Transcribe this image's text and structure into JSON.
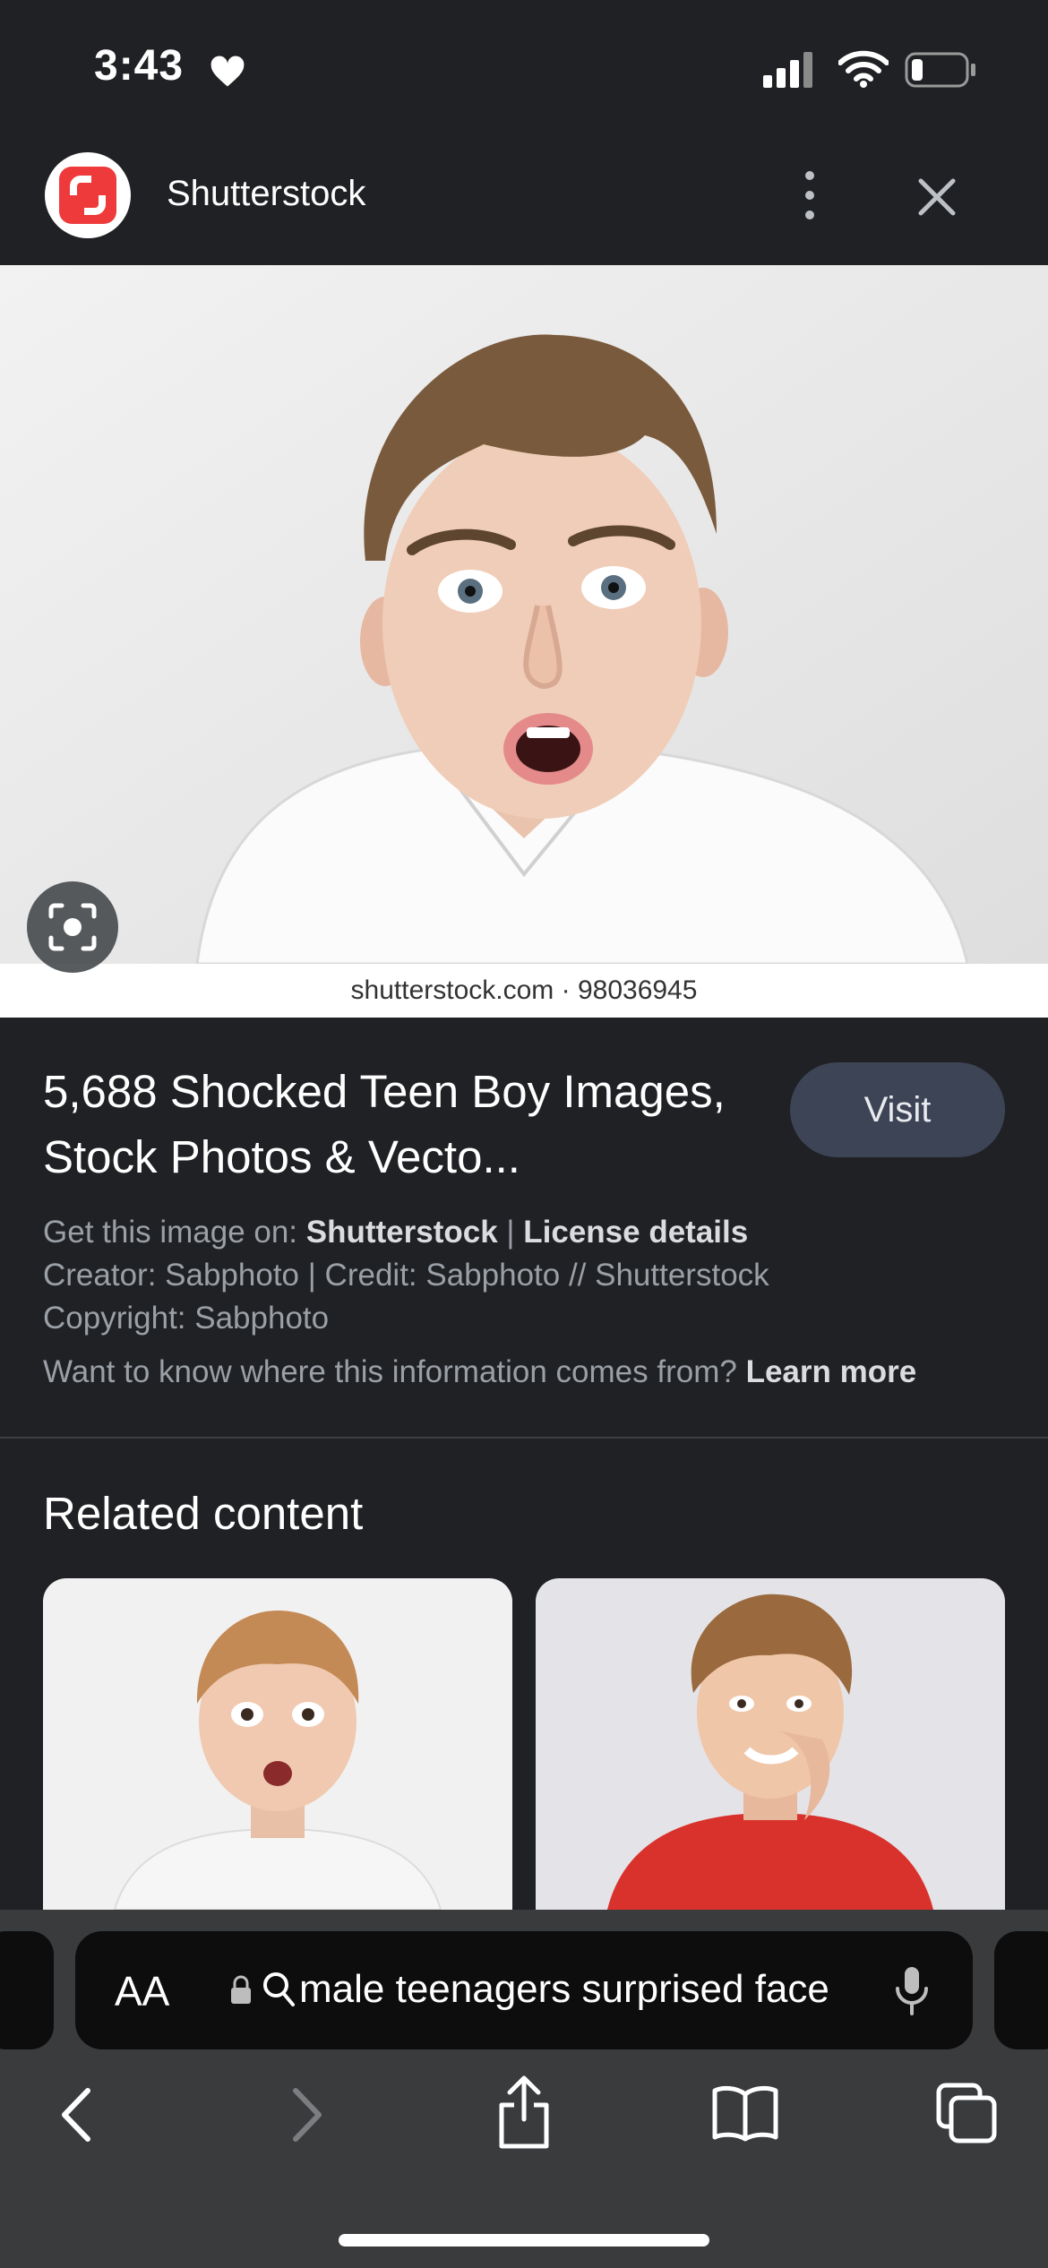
{
  "status_bar": {
    "time": "3:43"
  },
  "header": {
    "site_name": "Shutterstock"
  },
  "image": {
    "watermark": "shutterstock.com · 98036945"
  },
  "result": {
    "title": "5,688 Shocked Teen Boy Images, Stock Photos & Vecto...",
    "visit_label": "Visit",
    "source_prefix": "Get this image on: ",
    "source_name": "Shutterstock",
    "separator": " | ",
    "license_label": "License details",
    "creator_line": "Creator: Sabphoto | Credit: Sabphoto // Shutterstock",
    "copyright_line": "Copyright: Sabphoto",
    "info_question": "Want to know where this information comes from? ",
    "learn_more": "Learn more"
  },
  "related": {
    "heading": "Related content"
  },
  "toolbar": {
    "text_size_label": "AA",
    "address_text": "male teenagers surprised face"
  },
  "colors": {
    "background": "#202124",
    "brand_red": "#ee3a3a",
    "visit_button": "#3c4456",
    "toolbar": "#3a3b3d"
  },
  "icons": [
    "heart-icon",
    "signal-icon",
    "wifi-icon",
    "battery-icon",
    "shutterstock-logo",
    "more-vert-icon",
    "close-icon",
    "lens-icon",
    "lock-icon",
    "search-icon",
    "mic-icon",
    "back-icon",
    "forward-icon",
    "share-icon",
    "bookmarks-icon",
    "tabs-icon"
  ]
}
